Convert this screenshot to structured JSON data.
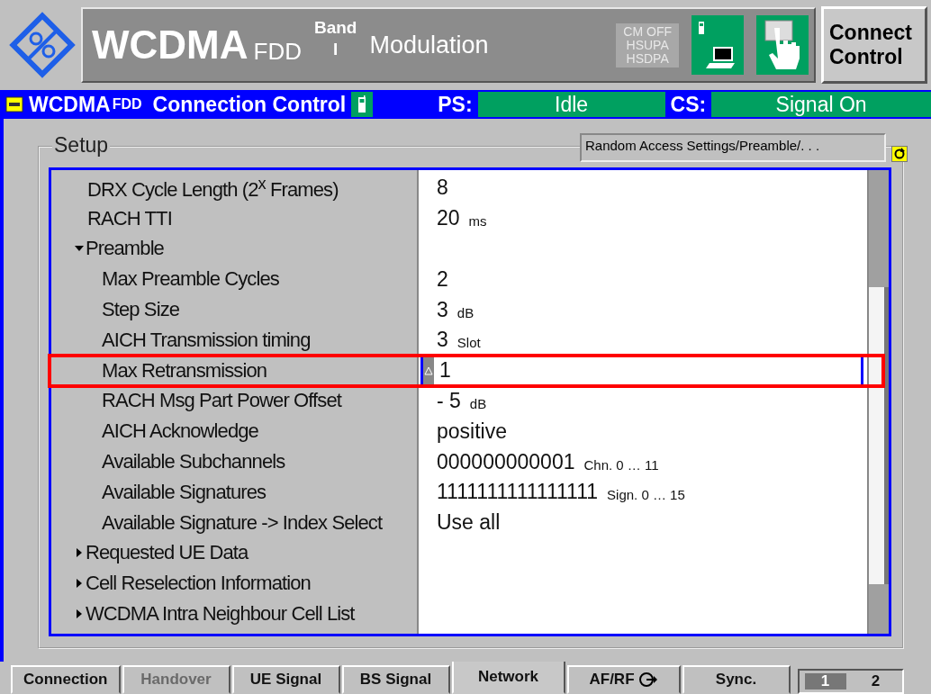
{
  "header": {
    "title": "WCDMA",
    "title_suffix": "FDD",
    "band_label": "Band",
    "band_value": "I",
    "mode": "Modulation",
    "flags": [
      "CM OFF",
      "HSUPA",
      "HSDPA"
    ],
    "connect_button": "Connect Control"
  },
  "status_bar": {
    "app": "WCDMA",
    "app_suffix": "FDD",
    "section": "Connection Control",
    "ps_label": "PS:",
    "ps_value": "Idle",
    "cs_label": "CS:",
    "cs_value": "Signal On"
  },
  "setup": {
    "title": "Setup",
    "breadcrumb": "Random Access Settings/Preamble/. . .",
    "items": [
      {
        "label": "DRX Cycle Length (2$^{x}$ Frames)",
        "value": "8"
      },
      {
        "label": "RACH TTI",
        "value": "20",
        "unit": "ms"
      },
      {
        "label": "Preamble",
        "expanded": true,
        "children": [
          {
            "label": "Max Preamble Cycles",
            "value": "2"
          },
          {
            "label": "Step Size",
            "value": "3",
            "unit": "dB"
          },
          {
            "label": "AICH Transmission timing",
            "value": "3",
            "unit": "Slot"
          },
          {
            "label": "Max Retransmission",
            "value": "1",
            "editing": true,
            "highlighted": true
          },
          {
            "label": "RACH Msg Part Power Offset",
            "value": "- 5",
            "unit": "dB"
          },
          {
            "label": "AICH Acknowledge",
            "value": "positive"
          },
          {
            "label": "Available Subchannels",
            "value": "000000000001",
            "unit": "Chn. 0 … 11"
          },
          {
            "label": "Available Signatures",
            "value": "1111111111111111",
            "unit": "Sign. 0 … 15"
          },
          {
            "label": "Available Signature -> Index Select",
            "value": "Use all"
          }
        ]
      },
      {
        "label": "Requested UE Data",
        "expanded": false
      },
      {
        "label": "Cell Reselection Information",
        "expanded": false
      },
      {
        "label": "WCDMA Intra Neighbour Cell List",
        "expanded": false
      }
    ]
  },
  "tabs": [
    {
      "label": "Connection",
      "selected": false,
      "disabled": false
    },
    {
      "label": "Handover",
      "selected": false,
      "disabled": true
    },
    {
      "label": "UE Signal",
      "selected": false,
      "disabled": false
    },
    {
      "label": "BS Signal",
      "selected": false,
      "disabled": false
    },
    {
      "label": "Network",
      "selected": true,
      "disabled": false
    },
    {
      "label": "AF/RF",
      "selected": false,
      "disabled": false,
      "kind": "icon"
    },
    {
      "label": "Sync.",
      "selected": false,
      "disabled": false
    }
  ],
  "pages": [
    {
      "label": "1",
      "selected": true
    },
    {
      "label": "2",
      "selected": false
    }
  ]
}
